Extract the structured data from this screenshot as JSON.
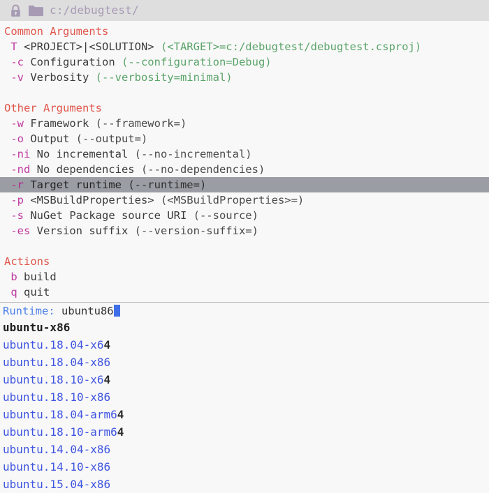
{
  "titlebar": {
    "lock_icon": "lock-icon",
    "folder_icon": "folder-icon",
    "path": "c:/debugtest/",
    "bg": "#dedede",
    "icon_color": "#a79ab5",
    "text_color": "#a79ab5"
  },
  "colors": {
    "section_header": "#e0554b",
    "flag": "#c0399f",
    "paren_green": "#5aa469",
    "paren_dark": "#4a4a4a",
    "selection": "#9a9ea4",
    "prompt": "#4a7fe8",
    "caret": "#3f6fe8",
    "match": "#2b2b2b",
    "unmatch": "#3f55e0",
    "background": "#f8f8f8"
  },
  "sections": [
    {
      "header": "Common Arguments",
      "rows": [
        {
          "flag": " T",
          "label": " <PROJECT>|<SOLUTION> ",
          "paren": "(<TARGET>=c:/debugtest/debugtest.csproj)",
          "paren_style": "green",
          "selected": false
        },
        {
          "flag": " -c",
          "label": " Configuration ",
          "paren": "(--configuration=Debug)",
          "paren_style": "green",
          "selected": false
        },
        {
          "flag": " -v",
          "label": " Verbosity ",
          "paren": "(--verbosity=minimal)",
          "paren_style": "green",
          "selected": false
        }
      ]
    },
    {
      "header": "Other Arguments",
      "rows": [
        {
          "flag": " -w",
          "label": " Framework ",
          "paren": "(--framework=)",
          "paren_style": "dark",
          "selected": false
        },
        {
          "flag": " -o",
          "label": " Output ",
          "paren": "(--output=)",
          "paren_style": "dark",
          "selected": false
        },
        {
          "flag": " -ni",
          "label": " No incremental ",
          "paren": "(--no-incremental)",
          "paren_style": "dark",
          "selected": false
        },
        {
          "flag": " -nd",
          "label": " No dependencies ",
          "paren": "(--no-dependencies)",
          "paren_style": "dark",
          "selected": false
        },
        {
          "flag": " -r",
          "label": " Target runtime ",
          "paren": "(--runtime=)",
          "paren_style": "dark",
          "selected": true
        },
        {
          "flag": " -p",
          "label": " <MSBuildProperties> ",
          "paren": "(<MSBuildProperties>=)",
          "paren_style": "dark",
          "selected": false
        },
        {
          "flag": " -s",
          "label": " NuGet Package source URI ",
          "paren": "(--source)",
          "paren_style": "dark",
          "selected": false
        },
        {
          "flag": " -es",
          "label": " Version suffix ",
          "paren": "(--version-suffix=)",
          "paren_style": "dark",
          "selected": false
        }
      ]
    },
    {
      "header": "Actions",
      "rows": [
        {
          "flag": " b",
          "label": " build",
          "paren": "",
          "paren_style": "dark",
          "selected": false
        },
        {
          "flag": " q",
          "label": " quit",
          "paren": "",
          "paren_style": "dark",
          "selected": false
        }
      ]
    }
  ],
  "prompt": {
    "label": "Runtime:",
    "value": " ubuntu86",
    "caret_visible": true
  },
  "completions": [
    {
      "selected": true,
      "segments": [
        {
          "t": "ubuntu-x86",
          "m": true
        }
      ]
    },
    {
      "selected": false,
      "segments": [
        {
          "t": "ubuntu.18.04-x6",
          "m": false
        },
        {
          "t": "4",
          "m": true
        }
      ]
    },
    {
      "selected": false,
      "segments": [
        {
          "t": "ubuntu.18.04-x86",
          "m": false
        }
      ]
    },
    {
      "selected": false,
      "segments": [
        {
          "t": "ubuntu.18.10-x6",
          "m": false
        },
        {
          "t": "4",
          "m": true
        }
      ]
    },
    {
      "selected": false,
      "segments": [
        {
          "t": "ubuntu.18.10-x86",
          "m": false
        }
      ]
    },
    {
      "selected": false,
      "segments": [
        {
          "t": "ubuntu.18.04-arm6",
          "m": false
        },
        {
          "t": "4",
          "m": true
        }
      ]
    },
    {
      "selected": false,
      "segments": [
        {
          "t": "ubuntu.18.10-arm6",
          "m": false
        },
        {
          "t": "4",
          "m": true
        }
      ]
    },
    {
      "selected": false,
      "segments": [
        {
          "t": "ubuntu.14.04-x86",
          "m": false
        }
      ]
    },
    {
      "selected": false,
      "segments": [
        {
          "t": "ubuntu.14.10-x86",
          "m": false
        }
      ]
    },
    {
      "selected": false,
      "segments": [
        {
          "t": "ubuntu.15.04-x86",
          "m": false
        }
      ]
    }
  ]
}
